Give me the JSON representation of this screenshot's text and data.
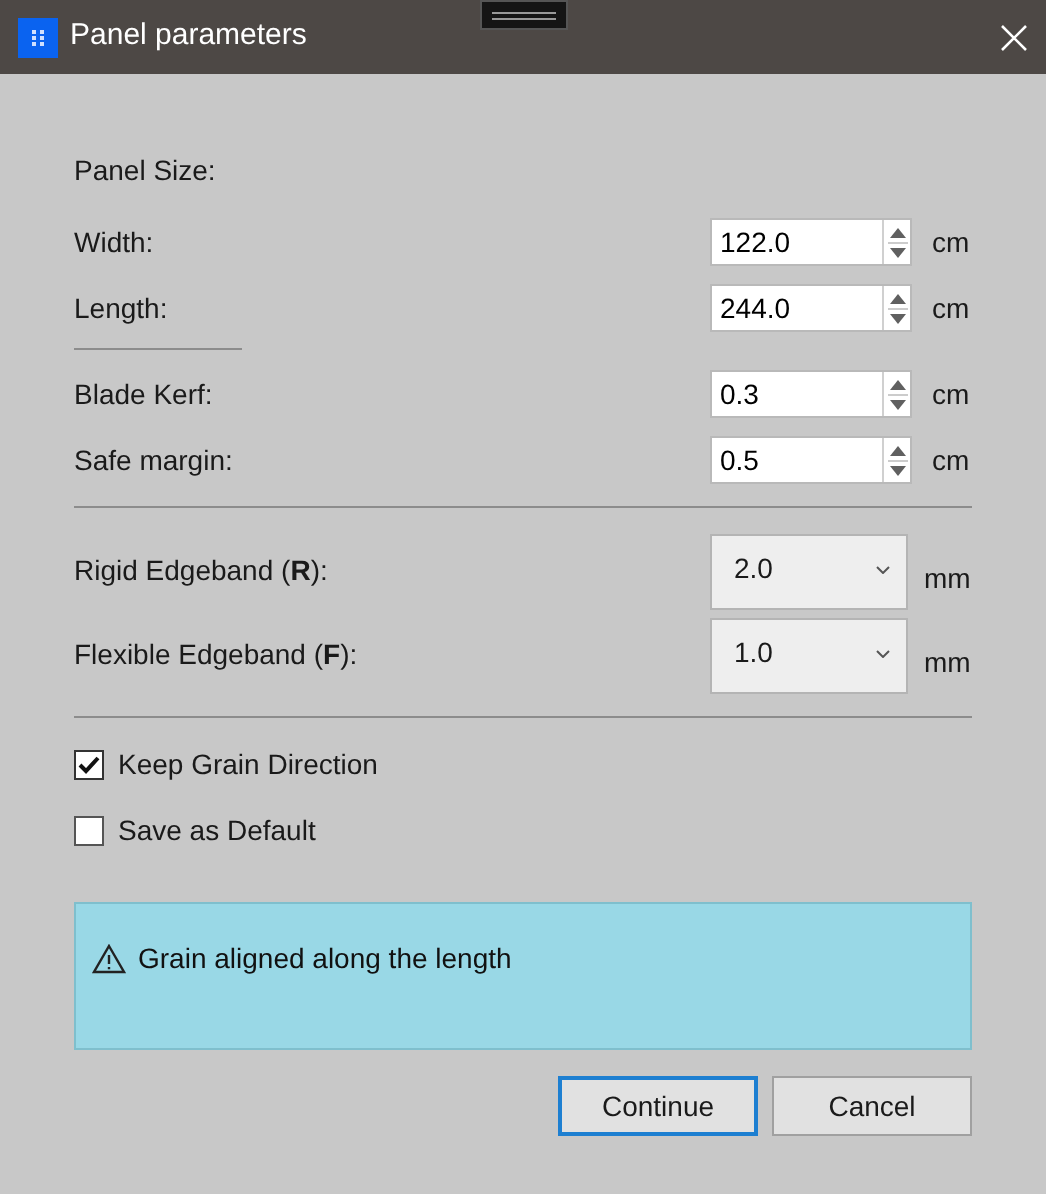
{
  "window": {
    "title": "Panel parameters"
  },
  "groups": [
    {
      "heading": "Panel Size:",
      "fields": [
        {
          "kind": "spin",
          "label": "Width:",
          "value": "122.0",
          "unit": "cm"
        },
        {
          "kind": "spin",
          "label": "Length:",
          "value": "244.0",
          "unit": "cm"
        }
      ]
    },
    {
      "fields": [
        {
          "kind": "spin",
          "label": "Blade Kerf:",
          "value": "0.3",
          "unit": "cm"
        },
        {
          "kind": "spin",
          "label": "Safe margin:",
          "value": "0.5",
          "unit": "cm"
        }
      ]
    },
    {
      "fields": [
        {
          "kind": "select",
          "label": "Rigid Edgeband  (**R**):",
          "value": "2.0",
          "unit": "mm"
        },
        {
          "kind": "select",
          "label": "Flexible Edgeband (**F**):",
          "value": "1.0",
          "unit": "mm"
        }
      ]
    }
  ],
  "checkboxes": [
    {
      "label": "Keep Grain Direction",
      "checked": true
    },
    {
      "label": "Save as Default",
      "checked": false
    }
  ],
  "info": {
    "text": "Grain aligned along the length"
  },
  "buttons": [
    {
      "label": "Continue",
      "selected": true
    },
    {
      "label": "Cancel",
      "selected": false
    }
  ]
}
